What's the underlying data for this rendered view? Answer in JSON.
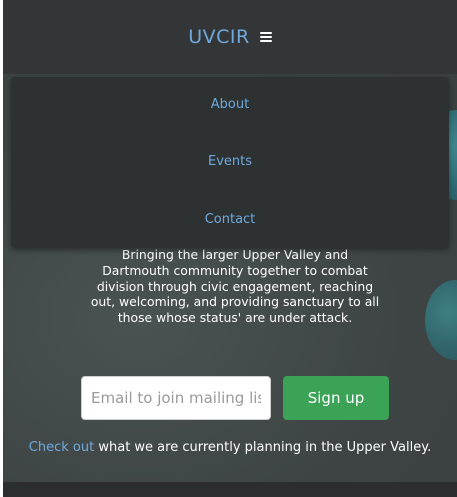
{
  "header": {
    "brand": "UVCIR",
    "menu_icon": "hamburger-menu-icon"
  },
  "menu": {
    "items": [
      {
        "label": "About"
      },
      {
        "label": "Events"
      },
      {
        "label": "Contact"
      }
    ]
  },
  "hero": {
    "tagline": "Bringing the larger Upper Valley and Dartmouth community together to combat division through civic engagement, reaching out, welcoming, and providing sanctuary to all those whose status' are under attack."
  },
  "signup": {
    "email_placeholder": "Email to join mailing list",
    "email_value": "",
    "button_label": "Sign up"
  },
  "cta": {
    "link_text": "Check out",
    "rest_text": " what we are currently planning in the Upper Valley."
  },
  "colors": {
    "brand": "#6fa8dc",
    "header_bg": "#333536",
    "menu_bg": "#2e3131",
    "signup_button": "#3aa356",
    "hero_bg": "#3f4545"
  }
}
